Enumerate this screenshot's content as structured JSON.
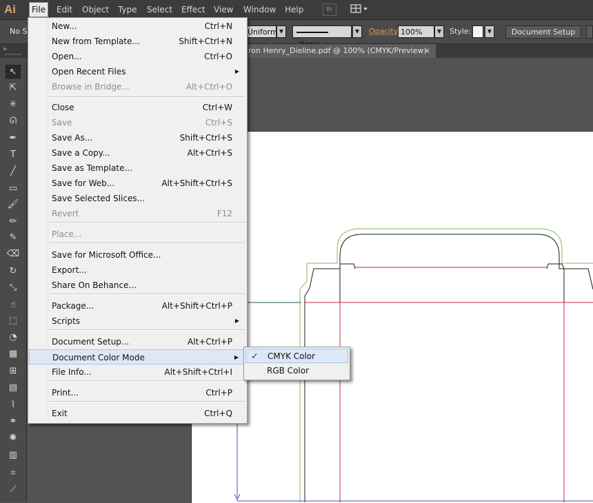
{
  "app": {
    "logo_text": "Ai"
  },
  "menubar": {
    "items": [
      "File",
      "Edit",
      "Object",
      "Type",
      "Select",
      "Effect",
      "View",
      "Window",
      "Help"
    ],
    "bridge_label": "Br",
    "workspace_icon": "arrange-documents-icon"
  },
  "controlbar": {
    "selection_text": "No Se",
    "stroke_profile": "Uniform",
    "brush_label": "Basic",
    "opacity_label": "Opacity:",
    "opacity_value": "100%",
    "style_label": "Style:",
    "document_setup_label": "Document Setup"
  },
  "document_tab": {
    "title": "ron Henry_Dieline.pdf @ 100% (CMYK/Preview)",
    "close": "×"
  },
  "panel_collapse": "»",
  "tools": [
    {
      "name": "selection-tool-icon",
      "glyph": "↖"
    },
    {
      "name": "direct-selection-tool-icon",
      "glyph": "⇱"
    },
    {
      "name": "magic-wand-tool-icon",
      "glyph": "✳"
    },
    {
      "name": "lasso-tool-icon",
      "glyph": "ᘏ"
    },
    {
      "name": "pen-tool-icon",
      "glyph": "✒"
    },
    {
      "name": "type-tool-icon",
      "glyph": "T"
    },
    {
      "name": "line-tool-icon",
      "glyph": "╱"
    },
    {
      "name": "rectangle-tool-icon",
      "glyph": "▭"
    },
    {
      "name": "paintbrush-tool-icon",
      "glyph": "🖌"
    },
    {
      "name": "pencil-tool-icon",
      "glyph": "✏"
    },
    {
      "name": "blob-brush-tool-icon",
      "glyph": "✎"
    },
    {
      "name": "eraser-tool-icon",
      "glyph": "⌫"
    },
    {
      "name": "rotate-tool-icon",
      "glyph": "↻"
    },
    {
      "name": "scale-tool-icon",
      "glyph": "⤡"
    },
    {
      "name": "warp-tool-icon",
      "glyph": "☝"
    },
    {
      "name": "free-transform-tool-icon",
      "glyph": "⬚"
    },
    {
      "name": "shape-builder-tool-icon",
      "glyph": "◔"
    },
    {
      "name": "perspective-grid-tool-icon",
      "glyph": "▦"
    },
    {
      "name": "mesh-tool-icon",
      "glyph": "⊞"
    },
    {
      "name": "gradient-tool-icon",
      "glyph": "▤"
    },
    {
      "name": "eyedropper-tool-icon",
      "glyph": "⌇"
    },
    {
      "name": "blend-tool-icon",
      "glyph": "⚭"
    },
    {
      "name": "symbol-sprayer-tool-icon",
      "glyph": "✺"
    },
    {
      "name": "column-graph-tool-icon",
      "glyph": "▥"
    },
    {
      "name": "artboard-tool-icon",
      "glyph": "⌗"
    },
    {
      "name": "slice-tool-icon",
      "glyph": "⟋"
    }
  ],
  "file_menu": {
    "items": [
      {
        "label": "New...",
        "shortcut": "Ctrl+N",
        "state": "enabled"
      },
      {
        "label": "New from Template...",
        "shortcut": "Shift+Ctrl+N",
        "state": "enabled"
      },
      {
        "label": "Open...",
        "shortcut": "Ctrl+O",
        "state": "enabled"
      },
      {
        "label": "Open Recent Files",
        "shortcut": "",
        "state": "submenu"
      },
      {
        "label": "Browse in Bridge...",
        "shortcut": "Alt+Ctrl+O",
        "state": "disabled"
      },
      {
        "label": "Close",
        "shortcut": "Ctrl+W",
        "state": "enabled"
      },
      {
        "label": "Save",
        "shortcut": "Ctrl+S",
        "state": "disabled"
      },
      {
        "label": "Save As...",
        "shortcut": "Shift+Ctrl+S",
        "state": "enabled"
      },
      {
        "label": "Save a Copy...",
        "shortcut": "Alt+Ctrl+S",
        "state": "enabled"
      },
      {
        "label": "Save as Template...",
        "shortcut": "",
        "state": "enabled"
      },
      {
        "label": "Save for Web...",
        "shortcut": "Alt+Shift+Ctrl+S",
        "state": "enabled"
      },
      {
        "label": "Save Selected Slices...",
        "shortcut": "",
        "state": "enabled"
      },
      {
        "label": "Revert",
        "shortcut": "F12",
        "state": "disabled"
      },
      {
        "label": "Place...",
        "shortcut": "",
        "state": "disabled"
      },
      {
        "label": "Save for Microsoft Office...",
        "shortcut": "",
        "state": "enabled"
      },
      {
        "label": "Export...",
        "shortcut": "",
        "state": "enabled"
      },
      {
        "label": "Share On Behance...",
        "shortcut": "",
        "state": "enabled"
      },
      {
        "label": "Package...",
        "shortcut": "Alt+Shift+Ctrl+P",
        "state": "enabled"
      },
      {
        "label": "Scripts",
        "shortcut": "",
        "state": "submenu"
      },
      {
        "label": "Document Setup...",
        "shortcut": "Alt+Ctrl+P",
        "state": "enabled"
      },
      {
        "label": "Document Color Mode",
        "shortcut": "",
        "state": "submenu-open"
      },
      {
        "label": "File Info...",
        "shortcut": "Alt+Shift+Ctrl+I",
        "state": "enabled"
      },
      {
        "label": "Print...",
        "shortcut": "Ctrl+P",
        "state": "enabled"
      },
      {
        "label": "Exit",
        "shortcut": "Ctrl+Q",
        "state": "enabled"
      }
    ]
  },
  "color_mode_submenu": {
    "items": [
      {
        "label": "CMYK Color",
        "checked": true,
        "check_mark": "✓"
      },
      {
        "label": "RGB Color",
        "checked": false,
        "check_mark": ""
      }
    ]
  },
  "colors": {
    "dieline_cut": "#1a1a1a",
    "bleed": "#7cbf5a",
    "crease": "#cc2233",
    "guide": "#3355aa",
    "menu_highlight": "#dde8f6"
  }
}
